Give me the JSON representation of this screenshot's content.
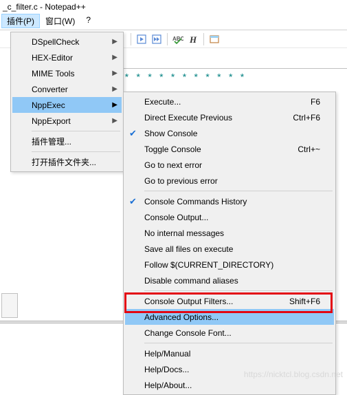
{
  "window": {
    "title_fragment": "_c_filter.c - Notepad++"
  },
  "menubar": {
    "plugins": "插件(P)",
    "window": "窗口(W)",
    "help": "?"
  },
  "editor": {
    "asterisks": "* * * * * * * * * * * * * * * * * * * *"
  },
  "plugins_menu": {
    "items": [
      {
        "label": "DSpellCheck",
        "arrow": true
      },
      {
        "label": "HEX-Editor",
        "arrow": true
      },
      {
        "label": "MIME Tools",
        "arrow": true
      },
      {
        "label": "Converter",
        "arrow": true
      },
      {
        "label": "NppExec",
        "arrow": true,
        "highlighted": true
      },
      {
        "label": "NppExport",
        "arrow": true
      }
    ],
    "manage": "插件管理...",
    "open_folder": "打开插件文件夹..."
  },
  "nppexec_menu": {
    "execute": "Execute...",
    "execute_sc": "F6",
    "direct_exec": "Direct Execute Previous",
    "direct_exec_sc": "Ctrl+F6",
    "show_console": "Show Console",
    "toggle_console": "Toggle Console",
    "toggle_console_sc": "Ctrl+~",
    "goto_next": "Go to next error",
    "goto_prev": "Go to previous error",
    "cmd_history": "Console Commands History",
    "console_output": "Console Output...",
    "no_internal": "No internal messages",
    "save_all": "Save all files on execute",
    "follow_dir": "Follow $(CURRENT_DIRECTORY)",
    "disable_alias": "Disable command aliases",
    "output_filters": "Console Output Filters...",
    "output_filters_sc": "Shift+F6",
    "advanced": "Advanced Options...",
    "change_font": "Change Console Font...",
    "help_manual": "Help/Manual",
    "help_docs": "Help/Docs...",
    "help_about": "Help/About..."
  },
  "watermark": "https://nicktcl.blog.csdn.net"
}
